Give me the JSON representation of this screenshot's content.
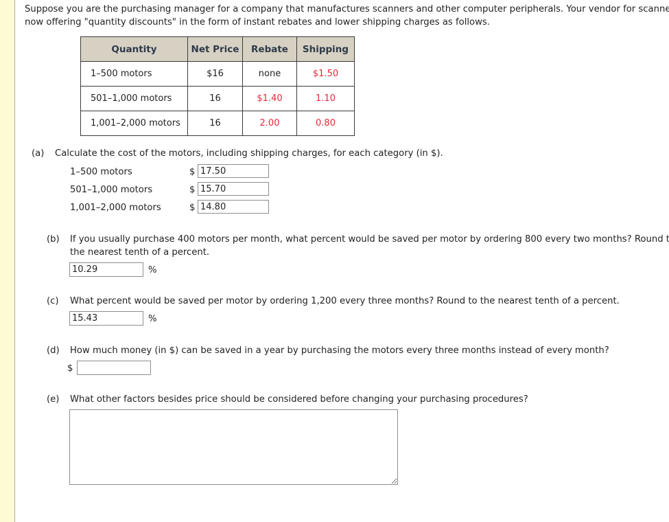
{
  "intro": {
    "text": "Suppose you are the purchasing manager for a company that manufactures scanners and other computer peripherals. Your vendor for scanner motors is now offering \"quantity discounts\" in the form of instant rebates and lower shipping charges as follows."
  },
  "table": {
    "headers": [
      "Quantity",
      "Net Price",
      "Rebate",
      "Shipping"
    ],
    "rows": [
      {
        "quantity": "1–500 motors",
        "net_price": "$16",
        "rebate": "none",
        "shipping": "$1.50"
      },
      {
        "quantity": "501–1,000 motors",
        "net_price": "16",
        "rebate": "$1.40",
        "shipping": "1.10"
      },
      {
        "quantity": "1,001–2,000 motors",
        "net_price": "16",
        "rebate": "2.00",
        "shipping": "0.80"
      }
    ],
    "header_bg": "#d6d1c3",
    "accent_red": "#e8273b"
  },
  "questions": {
    "a": {
      "marker": "(a)",
      "text": "Calculate the cost of the motors, including shipping charges, for each category (in $).",
      "rows": [
        {
          "label": "1–500 motors",
          "currency": "$",
          "value": "17.50"
        },
        {
          "label": "501–1,000 motors",
          "currency": "$",
          "value": "15.70"
        },
        {
          "label": "1,001–2,000 motors",
          "currency": "$",
          "value": "14.80"
        }
      ]
    },
    "b": {
      "marker": "(b)",
      "text": "If you usually purchase 400 motors per month, what percent would be saved per motor by ordering 800 every two months? Round to the nearest tenth of a percent.",
      "value": "10.29",
      "unit": "%"
    },
    "c": {
      "marker": "(c)",
      "text": "What percent would be saved per motor by ordering 1,200 every three months? Round to the nearest tenth of a percent.",
      "value": "15.43",
      "unit": "%"
    },
    "d": {
      "marker": "(d)",
      "text": "How much money (in $) can be saved in a year by purchasing the motors every three months instead of every month?",
      "currency": "$",
      "value": ""
    },
    "e": {
      "marker": "(e)",
      "text": "What other factors besides price should be considered before changing your purchasing procedures?",
      "value": ""
    }
  }
}
